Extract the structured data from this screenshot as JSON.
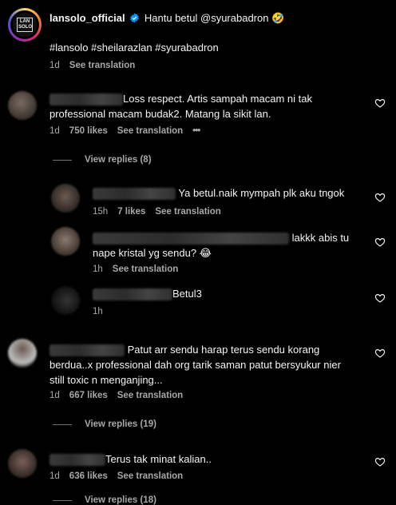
{
  "post": {
    "username": "lansolo_official",
    "caption": "Hantu betul @syurabadron",
    "emoji": "🤣",
    "hashtags": "#lansolo #sheilarazlan #syurabadron",
    "time": "1d",
    "see_translation": "See translation",
    "logo_text": "LAN SOLO"
  },
  "comments": [
    {
      "user": "...",
      "text_line1": "Loss respect. Artis sampah macam ni tak",
      "text_line2": "professional macam budak2. Matang la sikit lan.",
      "time": "1d",
      "likes": "750 likes",
      "translate": "See translation",
      "more": "•••",
      "view_replies": "View replies (8)"
    },
    {
      "text": "Ya betul.naik mympah plk aku tngok",
      "time": "15h",
      "likes": "7 likes",
      "translate": "See translation"
    },
    {
      "text_line1": "lakkk abis tu",
      "text_line2": "nape kristal yg sendu? 😂",
      "time": "1h",
      "translate": "See translation"
    },
    {
      "text": "Betul3",
      "time": "1h"
    },
    {
      "text_line1": "Patut arr sendu harap terus sendu korang",
      "text_line2": "berdua..x professional dah org tarik saman patut bersyukur nier",
      "text_line3": "still toxic n menganjing...",
      "time": "1d",
      "likes": "667 likes",
      "translate": "See translation",
      "view_replies": "View replies (19)"
    },
    {
      "text": "Terus tak minat kalian..",
      "time": "1d",
      "likes": "636 likes",
      "translate": "See translation",
      "view_replies": "View replies (18)"
    }
  ],
  "colors": {
    "background": "#000000",
    "text": "#f5f5f5",
    "muted": "#a8a8a8",
    "verified": "#0095f6",
    "ring": "#c13584"
  }
}
